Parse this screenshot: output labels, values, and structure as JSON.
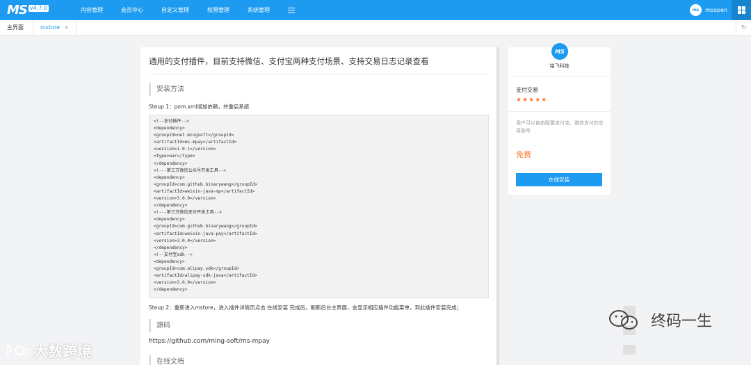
{
  "header": {
    "logo": "MS",
    "version": "v4.7.0",
    "nav": [
      "内容管理",
      "会员中心",
      "自定义管理",
      "权限管理",
      "系统管理"
    ],
    "avatar_text": "ms",
    "username": "msopen"
  },
  "tabs": {
    "home": "主界面",
    "active": "mstore",
    "close": "×",
    "refresh": "↻"
  },
  "main": {
    "title": "通用的支付插件，目前支持微信、支付宝两种支付场景、支持交易日志记录查看",
    "install_heading": "安装方法",
    "step1": "Steup 1：pom.xml增加依赖，并重启系统",
    "code_lines": [
      "<!--支付插件-->",
      "<dependency>",
      "<groupId>net.mingsoft</groupId>",
      "<artifactId>ms-mpay</artifactId>",
      "<version>1.0.1</version>",
      "<type>war</type>",
      "</dependency>",
      "<!---第三方微信公众号开发工具-->",
      "<dependency>",
      "<groupId>com.github.binarywang</groupId>",
      "<artifactId>weixin-java-mp</artifactId>",
      "<version>3.0.0</version>",
      "</dependency>",
      "<!---第三方微信支付开发工具-->",
      "<dependency>",
      "<groupId>com.github.binarywang</groupId>",
      "<artifactId>weixin-java-pay</artifactId>",
      "<version>3.0.0</version>",
      "</dependency>",
      "<!--支付宝sdk-->",
      "<dependency>",
      "<groupId>com.alipay.sdk</groupId>",
      "<artifactId>alipay-sdk-java</artifactId>",
      "<version>3.0.0</version>",
      "</dependency>"
    ],
    "step2": "Steup 2：重新进入mstore，进入插件详情页点击 在线安装  完成后，刷新后台主界面，会显示相应插件功能菜单，到此插件安装完成；",
    "source_heading": "源码",
    "source_link": "https://github.com/ming-soft/ms-mpay",
    "docs_heading": "在线文档"
  },
  "side": {
    "vendor_logo": "MS",
    "vendor_name": "铭飞科技",
    "plugin_name": "支付交易",
    "stars": "★★★★★",
    "rating": 5,
    "description": "用户可以自由配置支付宝、微信支付的交易账号",
    "price": "免费",
    "install_button": "在线安装"
  },
  "watermarks": {
    "left": "大数跨境",
    "right": "终码一生"
  },
  "colors": {
    "primary": "#1d9bf0",
    "accent": "#ff7a2f"
  }
}
